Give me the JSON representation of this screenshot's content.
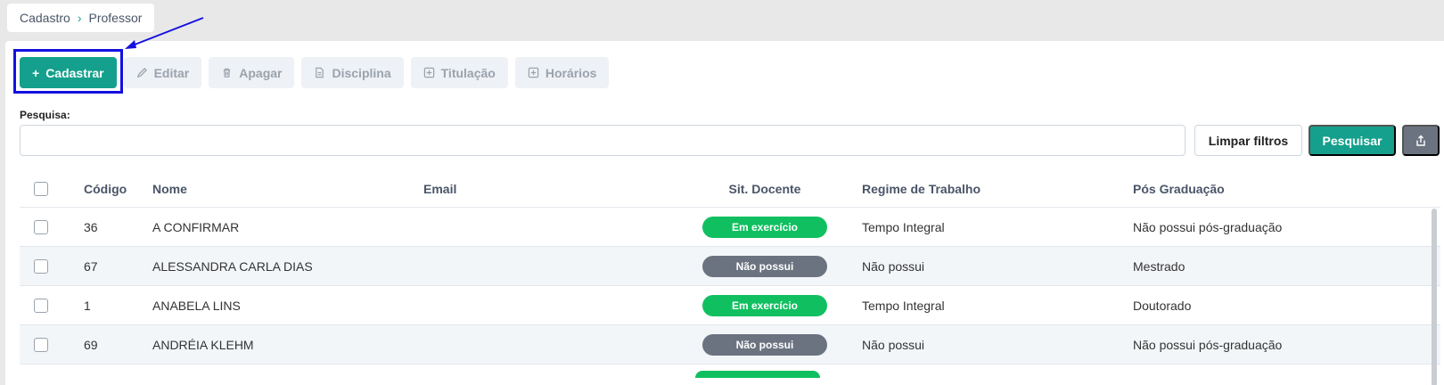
{
  "breadcrumb": {
    "root": "Cadastro",
    "current": "Professor"
  },
  "toolbar": {
    "cadastrar": "Cadastrar",
    "editar": "Editar",
    "apagar": "Apagar",
    "disciplina": "Disciplina",
    "titulacao": "Titulação",
    "horarios": "Horários"
  },
  "search": {
    "label": "Pesquisa:",
    "value": "",
    "clear": "Limpar filtros",
    "submit": "Pesquisar"
  },
  "table": {
    "headers": {
      "codigo": "Código",
      "nome": "Nome",
      "email": "Email",
      "sit": "Sit. Docente",
      "regime": "Regime de Trabalho",
      "pos": "Pós Graduação"
    },
    "rows": [
      {
        "codigo": "36",
        "nome": "A CONFIRMAR",
        "email": "",
        "sit": "Em exercício",
        "regime": "Tempo Integral",
        "pos": "Não possui pós-graduação"
      },
      {
        "codigo": "67",
        "nome": "ALESSANDRA CARLA DIAS",
        "email": "",
        "sit": "Não possui",
        "regime": "Não possui",
        "pos": "Mestrado"
      },
      {
        "codigo": "1",
        "nome": "ANABELA LINS",
        "email": "",
        "sit": "Em exercício",
        "regime": "Tempo Integral",
        "pos": "Doutorado"
      },
      {
        "codigo": "69",
        "nome": "ANDRÉIA KLEHM",
        "email": "",
        "sit": "Não possui",
        "regime": "Não possui",
        "pos": "Não possui pós-graduação"
      }
    ]
  },
  "colors": {
    "primary": "#14a08c",
    "active": "#10c060",
    "inactive": "#6b7380",
    "highlight": "#1410e0"
  }
}
